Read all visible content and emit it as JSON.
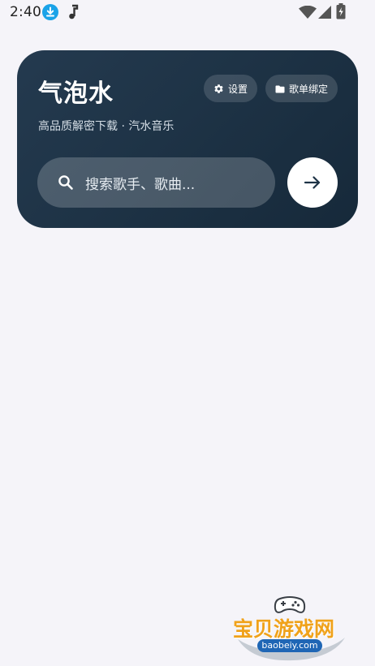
{
  "status_bar": {
    "time": "2:40",
    "icons": [
      "download-icon",
      "music-note-icon",
      "wifi-icon",
      "cell-signal-icon",
      "battery-charging-icon"
    ],
    "download_color": "#1aa3e8"
  },
  "header": {
    "title": "气泡水",
    "subtitle": "高品质解密下载 · 汽水音乐",
    "settings_label": "设置",
    "bind_label": "歌单绑定",
    "card_color": "#1e3346"
  },
  "search": {
    "placeholder": "搜索歌手、歌曲..."
  },
  "watermark": {
    "text": "宝贝游戏网",
    "url": "baobeiy.com"
  }
}
